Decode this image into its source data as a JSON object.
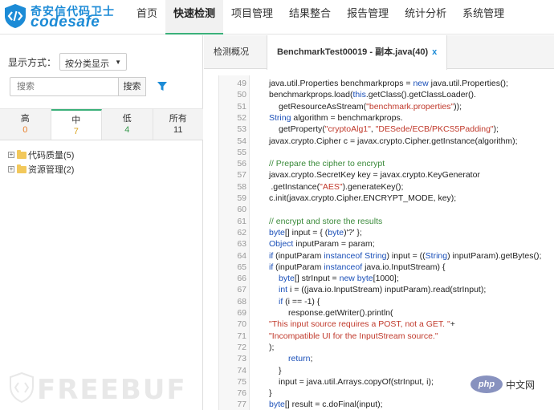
{
  "brand": {
    "name_cn": "奇安信代码卫士",
    "name_en": "codesafe"
  },
  "nav": {
    "items": [
      {
        "label": "首页",
        "active": false
      },
      {
        "label": "快速检测",
        "active": true
      },
      {
        "label": "项目管理",
        "active": false
      },
      {
        "label": "结果整合",
        "active": false
      },
      {
        "label": "报告管理",
        "active": false
      },
      {
        "label": "统计分析",
        "active": false
      },
      {
        "label": "系统管理",
        "active": false
      }
    ]
  },
  "left": {
    "display_label": "显示方式：",
    "display_select": "按分类显示",
    "search_placeholder": "搜索",
    "search_button": "搜索",
    "severity_tabs": [
      {
        "label": "高",
        "count": "0",
        "color": "#e8802c",
        "active": false
      },
      {
        "label": "中",
        "count": "7",
        "color": "#d9a21a",
        "active": true
      },
      {
        "label": "低",
        "count": "4",
        "color": "#3a9a4f",
        "active": false
      },
      {
        "label": "所有",
        "count": "11",
        "color": "#333333",
        "active": false
      }
    ],
    "tree": [
      {
        "label": "代码质量(5)"
      },
      {
        "label": "资源管理(2)"
      }
    ]
  },
  "right": {
    "tabs": [
      {
        "label": "检测概况",
        "active": false
      },
      {
        "label": "BenchmarkTest00019 - 副本.java(40)",
        "active": true,
        "close": "x"
      }
    ],
    "code_lines": [
      {
        "n": "49",
        "t": "java.util.Properties benchmarkprops = new java.util.Properties();",
        "i": 0
      },
      {
        "n": "50",
        "t": "benchmarkprops.load(this.getClass().getClassLoader().",
        "i": 0
      },
      {
        "n": "51",
        "t": "getResourceAsStream(\"benchmark.properties\"));",
        "i": 1
      },
      {
        "n": "52",
        "t": "String algorithm = benchmarkprops.",
        "i": 0
      },
      {
        "n": "53",
        "t": "getProperty(\"cryptoAlg1\", \"DESede/ECB/PKCS5Padding\");",
        "i": 1
      },
      {
        "n": "54",
        "t": "javax.crypto.Cipher c = javax.crypto.Cipher.getInstance(algorithm);",
        "i": 0
      },
      {
        "n": "55",
        "t": "",
        "i": 0
      },
      {
        "n": "56",
        "t": "// Prepare the cipher to encrypt",
        "i": 0,
        "c": true
      },
      {
        "n": "57",
        "t": "javax.crypto.SecretKey key = javax.crypto.KeyGenerator",
        "i": 0
      },
      {
        "n": "58",
        "t": ".getInstance(\"AES\").generateKey();",
        "i": 0.2
      },
      {
        "n": "59",
        "t": "c.init(javax.crypto.Cipher.ENCRYPT_MODE, key);",
        "i": 0
      },
      {
        "n": "60",
        "t": "",
        "i": 0
      },
      {
        "n": "61",
        "t": "// encrypt and store the results",
        "i": 0,
        "c": true
      },
      {
        "n": "62",
        "t": "byte[] input = { (byte)'?' };",
        "i": 0
      },
      {
        "n": "63",
        "t": "Object inputParam = param;",
        "i": 0
      },
      {
        "n": "64",
        "t": "if (inputParam instanceof String) input = ((String) inputParam).getBytes();",
        "i": 0
      },
      {
        "n": "65",
        "t": "if (inputParam instanceof java.io.InputStream) {",
        "i": 0
      },
      {
        "n": "66",
        "t": "byte[] strInput = new byte[1000];",
        "i": 1
      },
      {
        "n": "67",
        "t": "int i = ((java.io.InputStream) inputParam).read(strInput);",
        "i": 1
      },
      {
        "n": "68",
        "t": "if (i == -1) {",
        "i": 1
      },
      {
        "n": "69",
        "t": "response.getWriter().println(",
        "i": 2
      },
      {
        "n": "70",
        "t": "\"This input source requires a POST, not a GET. \"+",
        "i": 0
      },
      {
        "n": "71",
        "t": "\"Incompatible UI for the InputStream source.\"",
        "i": 0
      },
      {
        "n": "72",
        "t": ");",
        "i": 0
      },
      {
        "n": "73",
        "t": "return;",
        "i": 2
      },
      {
        "n": "74",
        "t": "}",
        "i": 1
      },
      {
        "n": "75",
        "t": "input = java.util.Arrays.copyOf(strInput, i);",
        "i": 1
      },
      {
        "n": "76",
        "t": "}",
        "i": 0
      },
      {
        "n": "77",
        "t": "byte[] result = c.doFinal(input);",
        "i": 0
      }
    ]
  },
  "watermark": {
    "text": "FREEBUF"
  },
  "badge": {
    "logo": "php",
    "text": "中文网"
  }
}
